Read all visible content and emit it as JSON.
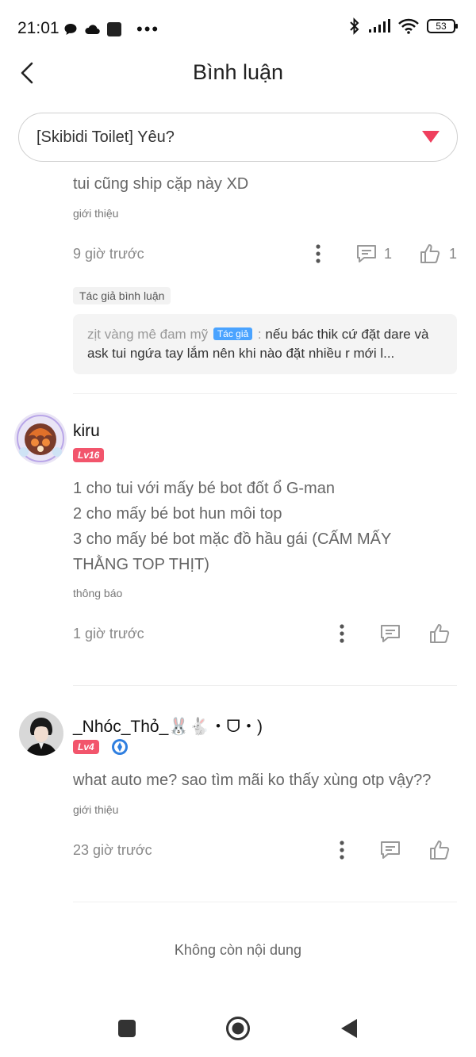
{
  "status_bar": {
    "time": "21:01",
    "dots": "•••",
    "battery": "53"
  },
  "header": {
    "title": "Bình luận"
  },
  "dropdown": {
    "selected": "[Skibidi Toilet] Yêu?"
  },
  "comment1": {
    "text": "tui cũng ship cặp này XD",
    "tag": "giới thiệu",
    "time": "9 giờ trước",
    "reply_count": "1",
    "like_count": "1",
    "author_label": "Tác giả bình luận",
    "reply": {
      "name": "zịt vàng mê đam mỹ",
      "badge": "Tác giả",
      "separator": " : ",
      "text": "nếu bác thik cứ đặt dare và ask tui ngứa tay lắm nên khi nào đặt nhiều r mới l..."
    }
  },
  "comment2": {
    "username": "kiru",
    "level": "Lv16",
    "lines": [
      "1 cho tui với mấy bé bot đốt ổ G-man",
      "2 cho mấy bé bot hun môi top",
      "3 cho mấy bé bot mặc đồ hầu gái (CẤM MẤY THẰNG TOP THỊT)"
    ],
    "tag": "thông báo",
    "time": "1 giờ trước"
  },
  "comment3": {
    "username": "_Nhóc_Thỏ_🐰🐇・ᗜ・)",
    "level": "Lv4",
    "text": "what auto me? sao tìm mãi ko thấy xùng otp vậy??",
    "tag": "giới thiệu",
    "time": "23 giờ trước"
  },
  "end_message": "Không còn nội dung",
  "colors": {
    "accent": "#ef3f5d",
    "level_badge": "#f2556c",
    "author_badge": "#4aa3ff"
  }
}
